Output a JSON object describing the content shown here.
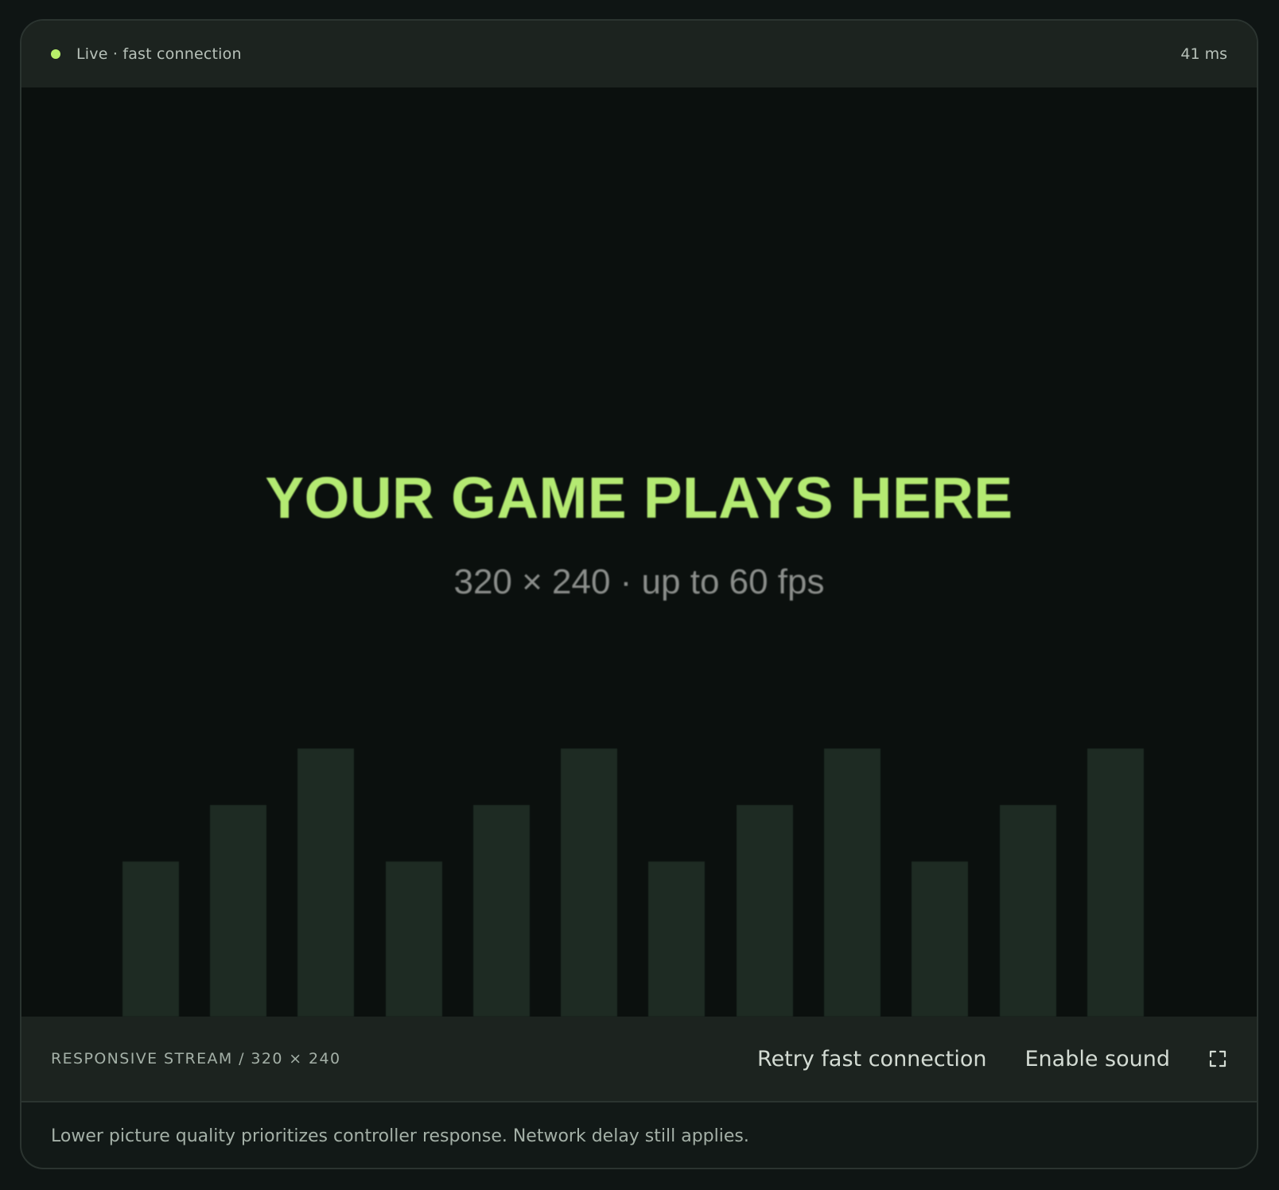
{
  "status": {
    "label": "Live · fast connection",
    "dot_color": "#b8f06a",
    "latency": "41 ms"
  },
  "viewport": {
    "title": "YOUR GAME PLAYS HERE",
    "subtitle": "320 × 240 · up to 60 fps"
  },
  "controls": {
    "stream_label": "RESPONSIVE STREAM / 320 × 240",
    "retry_label": "Retry fast connection",
    "sound_label": "Enable sound",
    "fullscreen_icon": "fullscreen-icon"
  },
  "footnote": "Lower picture quality prioritizes controller response. Network delay still applies."
}
